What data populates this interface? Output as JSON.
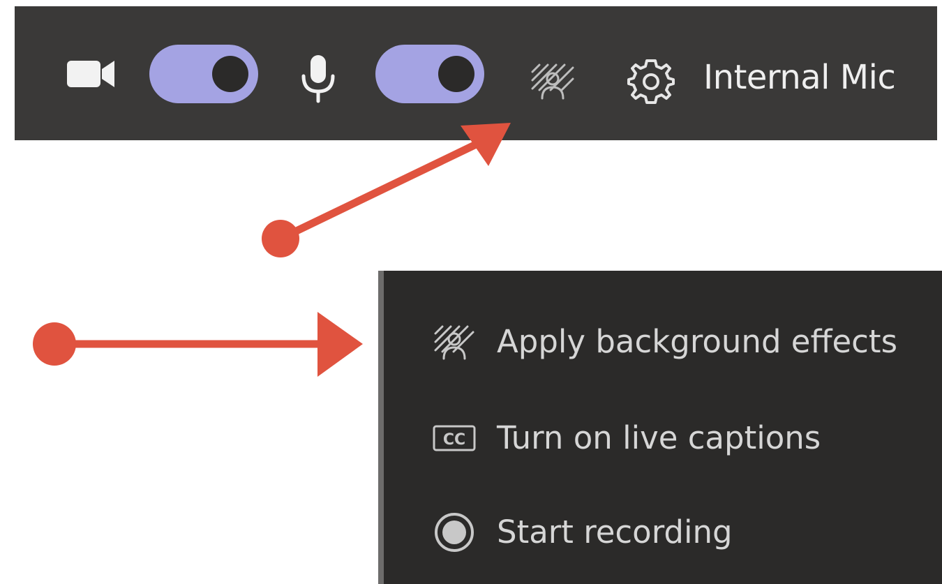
{
  "toolbar": {
    "camera_icon": "video-camera-icon",
    "camera_toggle_state": "on",
    "microphone_icon": "microphone-icon",
    "microphone_toggle_state": "on",
    "background_effects_icon": "background-effects-icon",
    "settings_icon": "gear-icon",
    "audio_device_label": "Internal Mic",
    "toggle_color": "#a4a3e3",
    "background_color": "#3a3938"
  },
  "menu": {
    "background_color": "#2b2a29",
    "items": [
      {
        "icon": "background-effects-icon",
        "label": "Apply background effects"
      },
      {
        "icon": "closed-captions-icon",
        "label": "Turn on live captions"
      },
      {
        "icon": "record-icon",
        "label": "Start recording"
      }
    ]
  },
  "annotations": {
    "arrow_color": "#e0533f"
  }
}
